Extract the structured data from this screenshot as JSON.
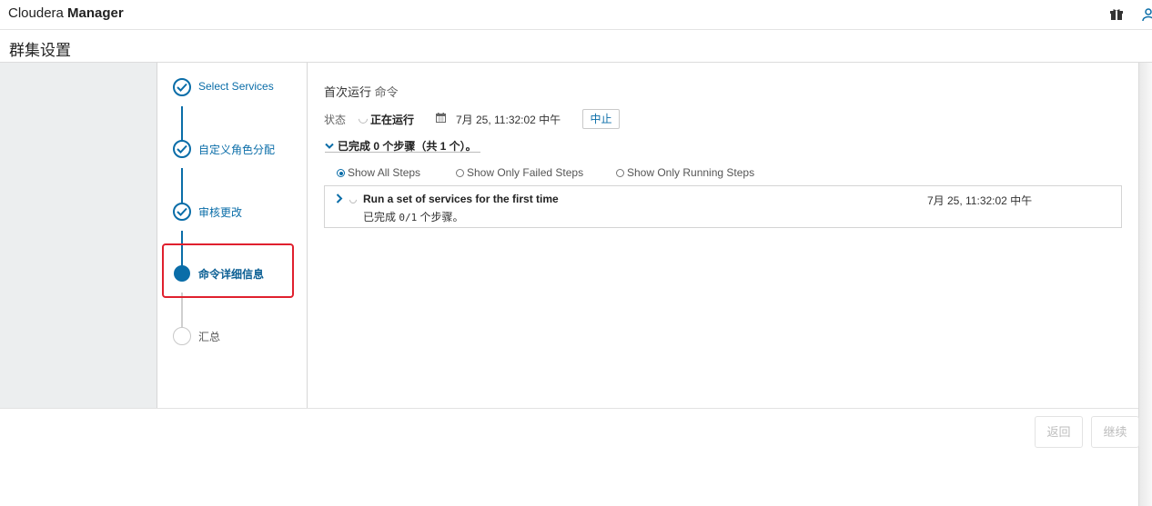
{
  "brand": {
    "light": "Cloudera ",
    "bold": "Manager"
  },
  "topbar_icons": [
    "gift-icon",
    "user-icon"
  ],
  "page": {
    "title": "群集设置"
  },
  "wizard": {
    "steps": [
      {
        "label": "Select Services",
        "state": "done"
      },
      {
        "label": "自定义角色分配",
        "state": "done"
      },
      {
        "label": "审核更改",
        "state": "done"
      },
      {
        "label": "命令详细信息",
        "state": "active"
      },
      {
        "label": "汇总",
        "state": "todo"
      }
    ]
  },
  "command": {
    "title": "首次运行",
    "title_suffix": "命令",
    "status_label": "状态",
    "status_value": "正在运行",
    "start_time": "7月 25, 11:32:02 中午",
    "abort_label": "中止",
    "summary": "已完成 0 个步骤（共 1 个）。",
    "filters": [
      {
        "label": "Show All Steps",
        "selected": true
      },
      {
        "label": "Show Only Failed Steps",
        "selected": false
      },
      {
        "label": "Show Only Running Steps",
        "selected": false
      }
    ],
    "step": {
      "name": "Run a set of services for the first time",
      "progress_prefix": "已完成 ",
      "progress_count": "0/1",
      "progress_suffix": " 个步骤。",
      "time": "7月 25, 11:32:02 中午"
    }
  },
  "footer": {
    "back_label": "返回",
    "next_label": "继续"
  },
  "colors": {
    "accent": "#0a6da8",
    "highlight": "#e0202e",
    "gutter": "#eceeef"
  }
}
